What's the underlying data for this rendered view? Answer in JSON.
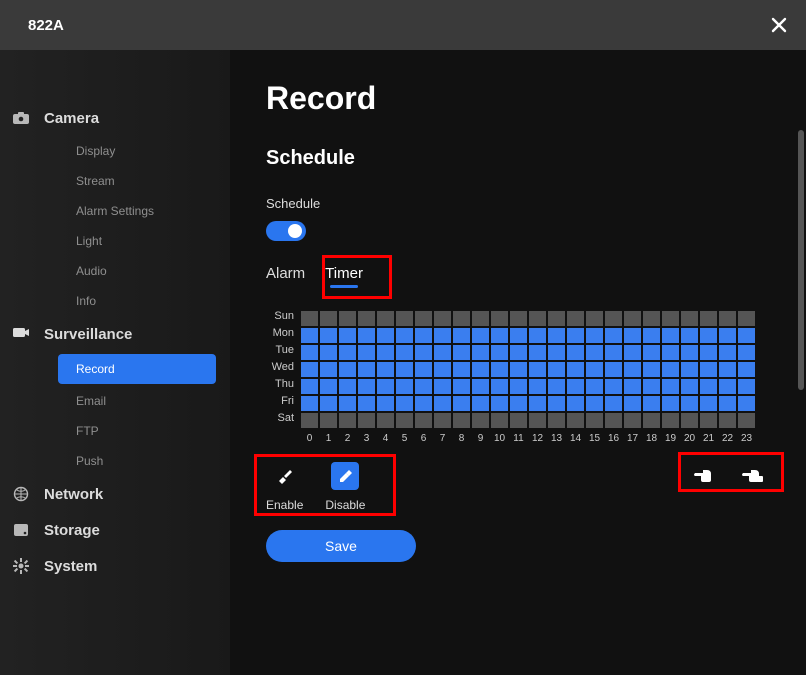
{
  "titlebar": {
    "title": "822A"
  },
  "sidebar": {
    "camera": {
      "label": "Camera",
      "items": [
        "Display",
        "Stream",
        "Alarm Settings",
        "Light",
        "Audio",
        "Info"
      ]
    },
    "surveillance": {
      "label": "Surveillance",
      "items": [
        "Record",
        "Email",
        "FTP",
        "Push"
      ],
      "active": "Record"
    },
    "network": {
      "label": "Network"
    },
    "storage": {
      "label": "Storage"
    },
    "system": {
      "label": "System"
    }
  },
  "main": {
    "page_title": "Record",
    "section_title": "Schedule",
    "toggle_label": "Schedule",
    "toggle_on": true,
    "tabs": {
      "alarm": "Alarm",
      "timer": "Timer",
      "active": "Timer"
    },
    "days": [
      "Sun",
      "Mon",
      "Tue",
      "Wed",
      "Thu",
      "Fri",
      "Sat"
    ],
    "hours": [
      "0",
      "1",
      "2",
      "3",
      "4",
      "5",
      "6",
      "7",
      "8",
      "9",
      "10",
      "11",
      "12",
      "13",
      "14",
      "15",
      "16",
      "17",
      "18",
      "19",
      "20",
      "21",
      "22",
      "23"
    ],
    "grid": {
      "Sun": [
        0,
        0,
        0,
        0,
        0,
        0,
        0,
        0,
        0,
        0,
        0,
        0,
        0,
        0,
        0,
        0,
        0,
        0,
        0,
        0,
        0,
        0,
        0,
        0
      ],
      "Mon": [
        1,
        1,
        1,
        1,
        1,
        1,
        1,
        1,
        1,
        1,
        1,
        1,
        1,
        1,
        1,
        1,
        1,
        1,
        1,
        1,
        1,
        1,
        1,
        1
      ],
      "Tue": [
        1,
        1,
        1,
        1,
        1,
        1,
        1,
        1,
        1,
        1,
        1,
        1,
        1,
        1,
        1,
        1,
        1,
        1,
        1,
        1,
        1,
        1,
        1,
        1
      ],
      "Wed": [
        1,
        1,
        1,
        1,
        1,
        1,
        1,
        1,
        1,
        1,
        1,
        1,
        1,
        1,
        1,
        1,
        1,
        1,
        1,
        1,
        1,
        1,
        1,
        1
      ],
      "Thu": [
        1,
        1,
        1,
        1,
        1,
        1,
        1,
        1,
        1,
        1,
        1,
        1,
        1,
        1,
        1,
        1,
        1,
        1,
        1,
        1,
        1,
        1,
        1,
        1
      ],
      "Fri": [
        1,
        1,
        1,
        1,
        1,
        1,
        1,
        1,
        1,
        1,
        1,
        1,
        1,
        1,
        1,
        1,
        1,
        1,
        1,
        1,
        1,
        1,
        1,
        1
      ],
      "Sat": [
        0,
        0,
        0,
        0,
        0,
        0,
        0,
        0,
        0,
        0,
        0,
        0,
        0,
        0,
        0,
        0,
        0,
        0,
        0,
        0,
        0,
        0,
        0,
        0
      ]
    },
    "tools": {
      "enable": "Enable",
      "disable": "Disable",
      "disable_active": true
    },
    "save_label": "Save"
  },
  "highlights": [
    {
      "name": "highlight-timer-tab"
    },
    {
      "name": "highlight-enable-disable"
    },
    {
      "name": "highlight-copy-tools"
    }
  ]
}
